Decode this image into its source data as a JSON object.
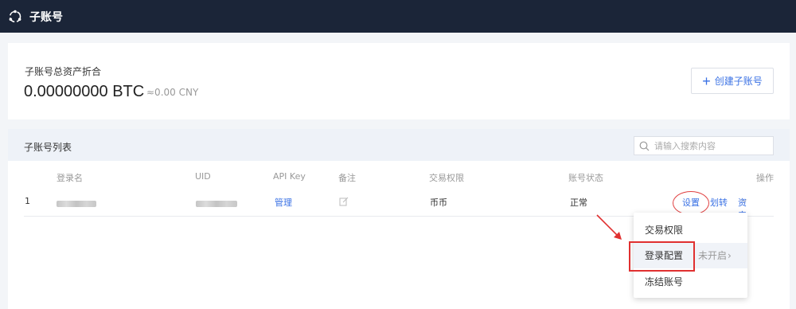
{
  "header": {
    "title": "子账号",
    "logo_icon": "logo-icon"
  },
  "summary": {
    "label": "子账号总资产折合",
    "btc_amount": "0.00000000 BTC",
    "cny_amount": "≈0.00 CNY",
    "create_button_label": "创建子账号"
  },
  "list": {
    "title": "子账号列表",
    "search_placeholder": "请输入搜索内容",
    "columns": {
      "login": "登录名",
      "uid": "UID",
      "api_key": "API Key",
      "remark": "备注",
      "trade_permission": "交易权限",
      "account_status": "账号状态",
      "actions": "操作"
    },
    "rows": [
      {
        "index": "1",
        "api_key": "管理",
        "trade_permission": "币币",
        "account_status": "正常",
        "action_settings": "设置",
        "action_transfer": "划转",
        "action_assets": "资产"
      }
    ]
  },
  "dropdown": {
    "items": [
      {
        "label": "交易权限"
      },
      {
        "label": "登录配置",
        "status": "未开启"
      },
      {
        "label": "冻结账号"
      }
    ]
  },
  "colors": {
    "topbar": "#1b2538",
    "accent": "#3a71e4",
    "highlight": "#e03030"
  }
}
